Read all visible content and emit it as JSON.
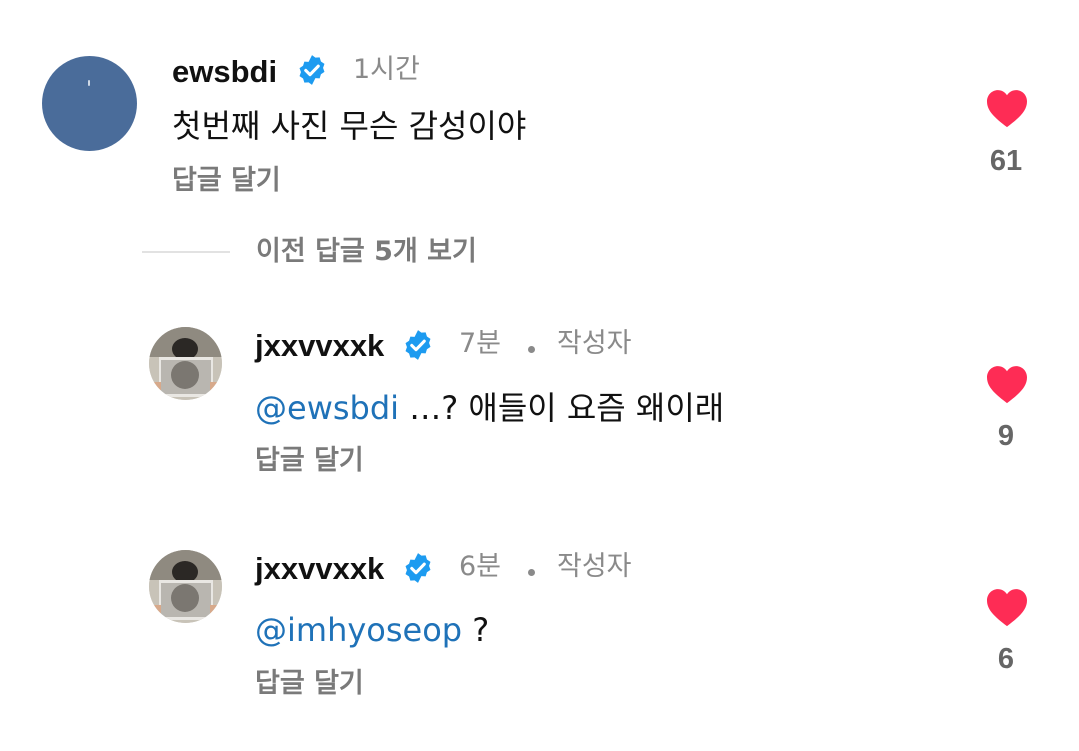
{
  "comment": {
    "username": "ewsbdi",
    "time": "1시간",
    "text": "첫번째 사진 무슨 감성이야",
    "reply_label": "답글 달기",
    "likes": "61"
  },
  "view_previous": "이전 답글 5개 보기",
  "replies": [
    {
      "username": "jxxvvxxk",
      "time": "7분",
      "author_badge": "작성자",
      "mention": "@ewsbdi",
      "text": " …? 애들이 요즘 왜이래",
      "reply_label": "답글 달기",
      "likes": "9"
    },
    {
      "username": "jxxvvxxk",
      "time": "6분",
      "author_badge": "작성자",
      "mention": "@imhyoseop",
      "text": " ?",
      "reply_label": "답글 달기",
      "likes": "6"
    }
  ],
  "colors": {
    "verified": "#1d9bf0",
    "heart": "#fe2c55",
    "mention": "#1f72b8"
  },
  "icons": [
    "verified-badge-icon",
    "heart-icon"
  ]
}
